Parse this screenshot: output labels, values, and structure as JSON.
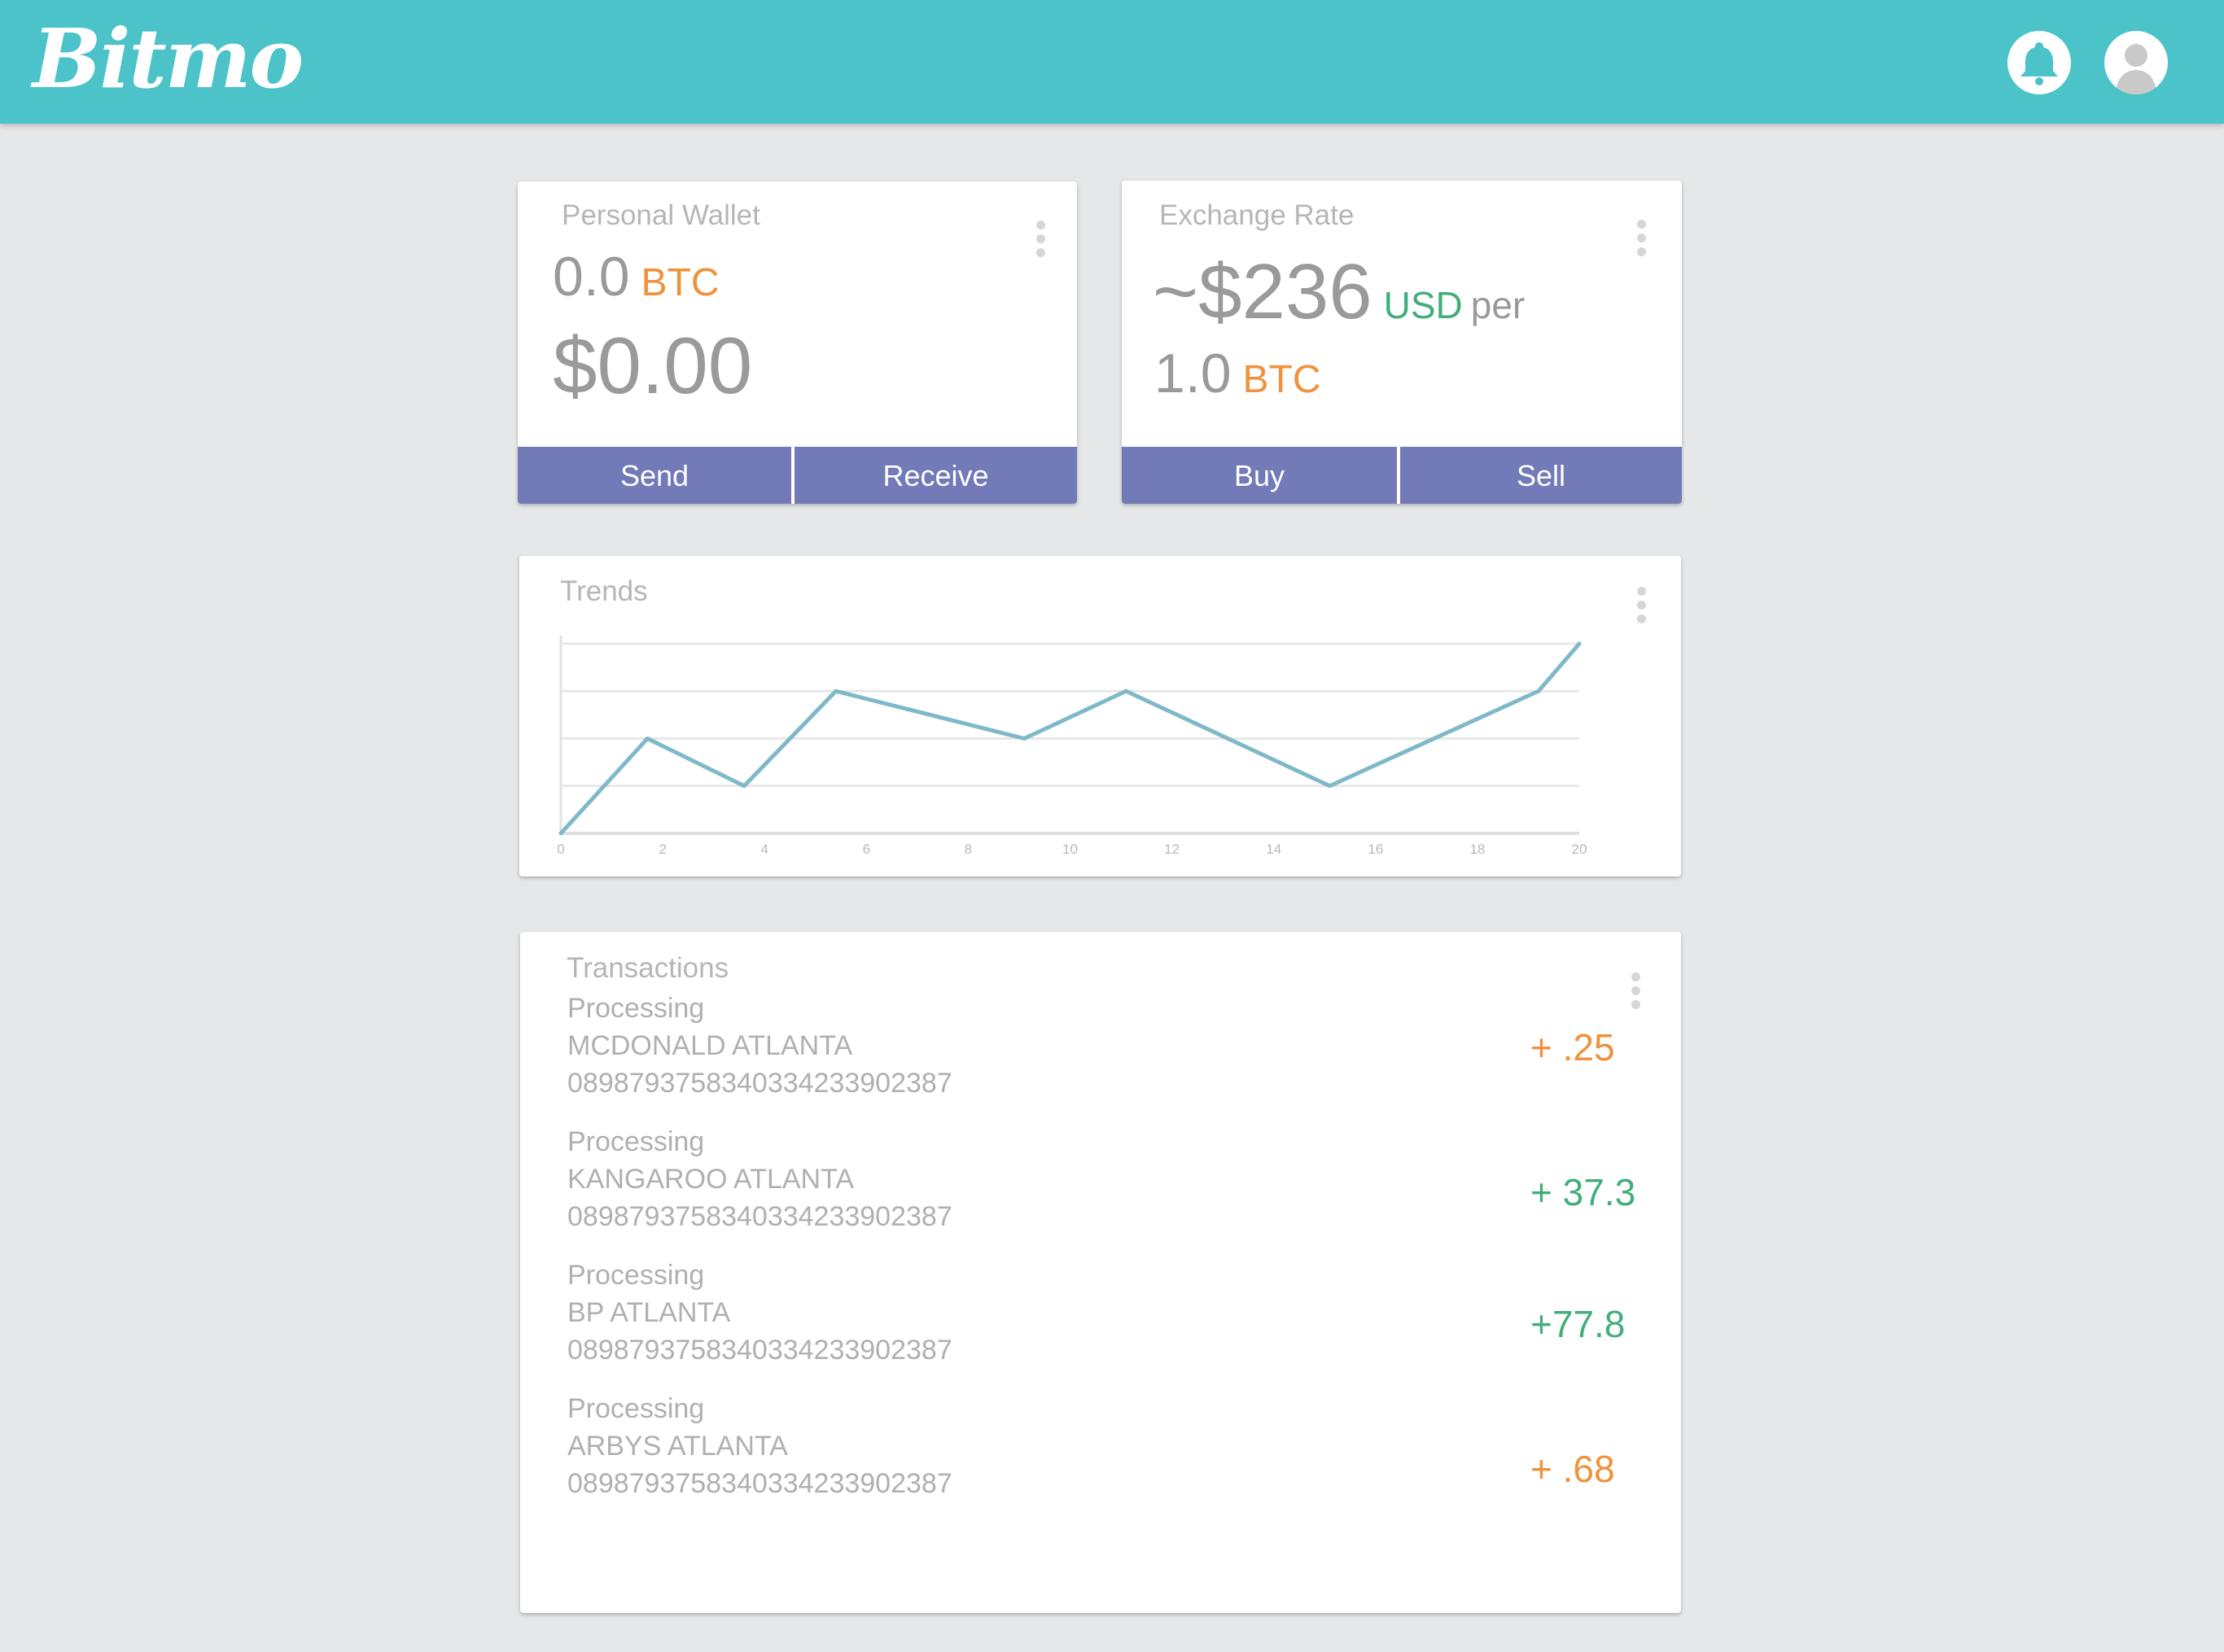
{
  "app": {
    "logo": "Bitmo"
  },
  "header": {
    "icons": [
      "bell-icon",
      "user-avatar-icon"
    ]
  },
  "colors": {
    "header": "#4bc3c8",
    "button": "#727ab8",
    "orange": "#f0913c",
    "green": "#43ae7c",
    "chart_line": "#7fb9c9"
  },
  "wallet": {
    "title": "Personal Wallet",
    "btc_value": "0.0",
    "btc_unit": "BTC",
    "usd_value": "$0.00",
    "send_label": "Send",
    "receive_label": "Receive"
  },
  "exchange": {
    "title": "Exchange Rate",
    "price": "~$236",
    "currency": "USD",
    "per": "per",
    "btc_value": "1.0",
    "btc_unit": "BTC",
    "buy_label": "Buy",
    "sell_label": "Sell"
  },
  "trends": {
    "title": "Trends"
  },
  "chart_data": {
    "type": "line",
    "title": "Trends",
    "xlabel": "",
    "ylabel": "",
    "x_ticks": [
      "0",
      "2",
      "4",
      "6",
      "8",
      "10",
      "12",
      "14",
      "16",
      "18",
      "20"
    ],
    "xlim": [
      0,
      20
    ],
    "ylim": [
      0,
      4
    ],
    "grid": true,
    "series": [
      {
        "x": [
          0,
          1.7,
          3.6,
          5.4,
          9.1,
          11.1,
          15.1,
          19.2,
          20
        ],
        "values": [
          0,
          2,
          1,
          3,
          2,
          3,
          1,
          3,
          4
        ]
      }
    ]
  },
  "transactions": {
    "title": "Transactions",
    "items": [
      {
        "status": "Processing",
        "merchant": "MCDONALD ATLANTA",
        "id": "0898793758340334233902387",
        "amount": "+ .25",
        "color": "#f0913c"
      },
      {
        "status": "Processing",
        "merchant": "KANGAROO ATLANTA",
        "id": "0898793758340334233902387",
        "amount": "+ 37.3",
        "color": "#43ae7c"
      },
      {
        "status": "Processing",
        "merchant": "BP ATLANTA",
        "id": "0898793758340334233902387",
        "amount": "+77.8",
        "color": "#43ae7c"
      },
      {
        "status": "Processing",
        "merchant": "ARBYS ATLANTA",
        "id": "0898793758340334233902387",
        "amount": "+ .68",
        "color": "#f0913c"
      }
    ]
  }
}
